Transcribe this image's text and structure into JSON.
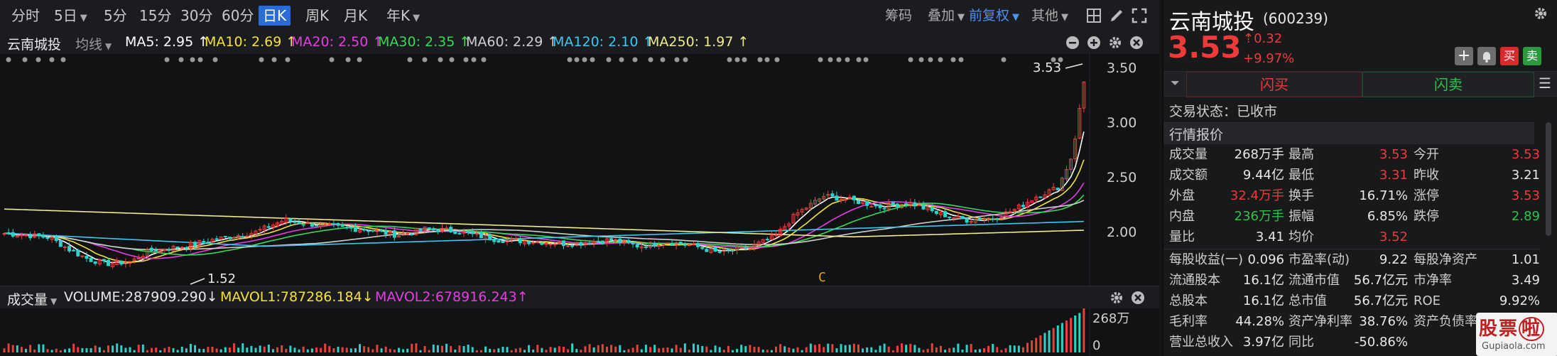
{
  "toolbar": {
    "periods": [
      "分时",
      "5日",
      "5分",
      "15分",
      "30分",
      "60分",
      "日K",
      "周K",
      "月K",
      "年K"
    ],
    "active_period": "日K",
    "right": {
      "chips": "筹码",
      "overlay": "叠加",
      "adjust": "前复权",
      "other": "其他"
    }
  },
  "chart_header": {
    "stock_name": "云南城投",
    "line_type": "均线",
    "ma": [
      {
        "label": "MA5: 2.95 ↑",
        "color": "#ffffff"
      },
      {
        "label": "MA10: 2.69 ↑",
        "color": "#f5e23a"
      },
      {
        "label": "MA20: 2.50 ↑",
        "color": "#e53ee0"
      },
      {
        "label": "MA30: 2.35 ↑",
        "color": "#38d957"
      },
      {
        "label": "MA60: 2.29 ↑",
        "color": "#cfcfcf"
      },
      {
        "label": "MA120: 2.10 ↑",
        "color": "#3ec8f0"
      },
      {
        "label": "MA250: 1.97 ↑",
        "color": "#f2ec8f"
      }
    ]
  },
  "price_axis": [
    "3.50",
    "3.00",
    "2.50",
    "2.00"
  ],
  "annotations": {
    "high": "3.53",
    "low": "1.52",
    "marker": "C"
  },
  "volume_header": {
    "label": "成交量",
    "volume": "VOLUME:287909.290↓",
    "mavol1": "MAVOL1:787286.184↓",
    "mavol2": "MAVOL2:678916.243↑",
    "mavol1_color": "#f5e23a",
    "mavol2_color": "#e53ee0"
  },
  "volume_axis": [
    "268万",
    "0"
  ],
  "panel": {
    "name": "云南城投",
    "code": "(600239)",
    "price": "3.53",
    "change": "0.32",
    "change_pct": "+9.97%",
    "buy_btn": "买",
    "sell_btn": "卖",
    "flash_buy": "闪买",
    "flash_sell": "闪卖",
    "trade_status": "交易状态：已收市",
    "quote_title": "行情报价",
    "quotes": [
      [
        [
          "成交量",
          "268万手",
          "white"
        ],
        [
          "最高",
          "3.53",
          "red"
        ],
        [
          "今开",
          "3.53",
          "red"
        ]
      ],
      [
        [
          "成交额",
          "9.44亿",
          "white"
        ],
        [
          "最低",
          "3.31",
          "red"
        ],
        [
          "昨收",
          "3.21",
          "white"
        ]
      ],
      [
        [
          "外盘",
          "32.4万手",
          "red"
        ],
        [
          "换手",
          "16.71%",
          "white"
        ],
        [
          "涨停",
          "3.53",
          "red"
        ]
      ],
      [
        [
          "内盘",
          "236万手",
          "green"
        ],
        [
          "振幅",
          "6.85%",
          "white"
        ],
        [
          "跌停",
          "2.89",
          "green"
        ]
      ],
      [
        [
          "量比",
          "3.41",
          "white"
        ],
        [
          "均价",
          "3.52",
          "red"
        ],
        [
          "",
          "",
          " "
        ]
      ]
    ],
    "finance": [
      [
        [
          "每股收益(一)",
          "0.096"
        ],
        [
          "市盈率(动)",
          "9.22"
        ],
        [
          "每股净资产",
          "1.01"
        ]
      ],
      [
        [
          "流通股本",
          "16.1亿"
        ],
        [
          "流通市值",
          "56.7亿元"
        ],
        [
          "市净率",
          "3.49"
        ]
      ],
      [
        [
          "总股本",
          "16.1亿"
        ],
        [
          "总市值",
          "56.7亿元"
        ],
        [
          "ROE",
          "9.92%"
        ]
      ],
      [
        [
          "毛利率",
          "44.28%"
        ],
        [
          "资产净利率",
          "38.76%"
        ],
        [
          "资产负债率",
          ""
        ]
      ],
      [
        [
          "营业总收入",
          "3.97亿"
        ],
        [
          "同比",
          "-50.86%"
        ],
        [
          "",
          ""
        ]
      ]
    ]
  }
}
